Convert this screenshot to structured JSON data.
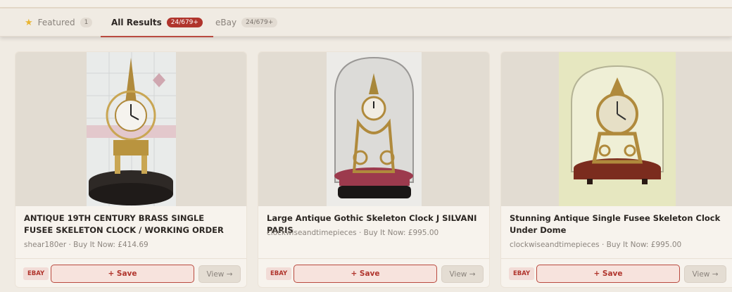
{
  "tabs": [
    {
      "label": "Featured",
      "count": "1",
      "icon": "star-icon"
    },
    {
      "label": "All Results",
      "count": "24/679+"
    },
    {
      "label": "eBay",
      "count": "24/679+"
    }
  ],
  "results": [
    {
      "title": "ANTIQUE 19TH CENTURY BRASS SINGLE FUSEE SKELETON CLOCK / WORKING ORDER",
      "meta": "shear180er · Buy It Now: £414.69",
      "source": "EBAY",
      "save": "+ Save",
      "view": "View →"
    },
    {
      "title": "Large Antique Gothic Skeleton Clock J SILVANI PARIS",
      "meta": "clockwiseandtimepieces · Buy It Now: £995.00",
      "source": "EBAY",
      "save": "+ Save",
      "view": "View →"
    },
    {
      "title": "Stunning Antique Single Fusee Skeleton Clock Under Dome",
      "meta": "clockwiseandtimepieces · Buy It Now: £995.00",
      "source": "EBAY",
      "save": "+ Save",
      "view": "View →"
    }
  ],
  "colors": {
    "accent": "#b0342c",
    "background": "#f0ebe3",
    "card": "#f7f3ed"
  }
}
